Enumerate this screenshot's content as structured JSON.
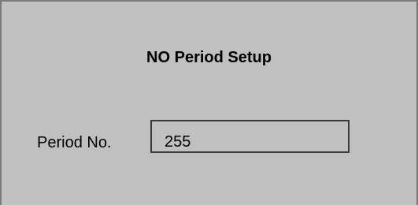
{
  "dialog": {
    "title": "NO Period Setup",
    "period_label": "Period No.",
    "period_value": "255"
  }
}
